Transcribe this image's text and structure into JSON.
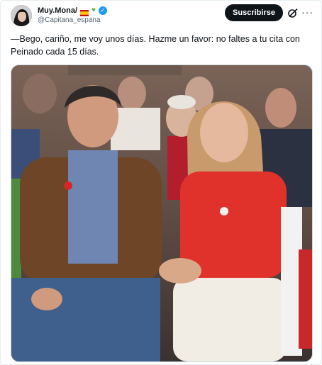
{
  "tweet": {
    "author_name": "Muy.Mona/",
    "handle": "@Capitana_espana",
    "subscribe_label": "Suscribirse",
    "more_label": "···",
    "body_text": "—Bego, cariño, me voy unos días. Hazme un favor: no faltes a tu cita con Peinado cada 15 días.",
    "icons": [
      "avatar",
      "spain-flag-icon",
      "green-heart-icon",
      "verified-icon",
      "grok-icon",
      "more-icon"
    ]
  },
  "colors": {
    "accent": "#1d9bf0",
    "button_bg": "#0f1419",
    "secondary_text": "#536471",
    "heart": "#59b84a"
  }
}
